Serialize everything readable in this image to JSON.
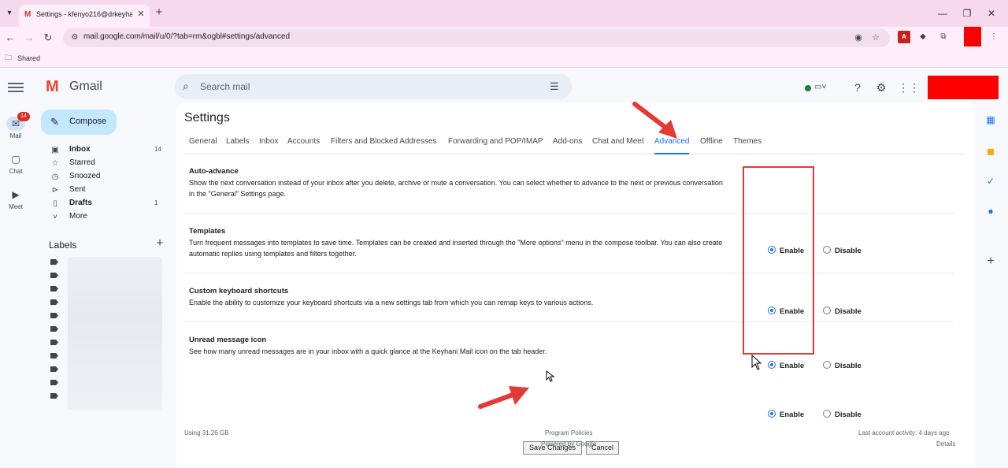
{
  "browser": {
    "tab_title": "Settings - kfenyo216@drkeyhani.c",
    "url": "mail.google.com/mail/u/0/?tab=rm&ogbl#settings/advanced",
    "bookmark": "Shared"
  },
  "gmail": {
    "logo_text": "Gmail",
    "search_placeholder": "Search mail",
    "compose_label": "Compose",
    "rail": [
      {
        "label": "Mail",
        "badge": "14"
      },
      {
        "label": "Chat"
      },
      {
        "label": "Meet"
      }
    ],
    "nav": [
      {
        "label": "Inbox",
        "count": "14",
        "bold": true
      },
      {
        "label": "Starred",
        "count": ""
      },
      {
        "label": "Snoozed",
        "count": ""
      },
      {
        "label": "Sent",
        "count": ""
      },
      {
        "label": "Drafts",
        "count": "1",
        "bold": true
      },
      {
        "label": "More",
        "count": ""
      }
    ],
    "labels_heading": "Labels"
  },
  "settings": {
    "title": "Settings",
    "tabs": [
      "General",
      "Labels",
      "Inbox",
      "Accounts",
      "Filters and Blocked Addresses",
      "Forwarding and POP/IMAP",
      "Add-ons",
      "Chat and Meet",
      "Advanced",
      "Offline",
      "Themes"
    ],
    "active_tab": "Advanced",
    "rows": [
      {
        "title": "Auto-advance",
        "description": "Show the next conversation instead of your inbox after you delete, archive or mute a conversation. You can select whether to advance to the next or previous conversation in the \"General\" Settings page.",
        "selected": "Enable"
      },
      {
        "title": "Templates",
        "description": "Turn frequent messages into templates to save time. Templates can be created and inserted through the \"More options\" menu in the compose toolbar. You can also create automatic replies using templates and filters together.",
        "selected": "Enable"
      },
      {
        "title": "Custom keyboard shortcuts",
        "description": "Enable the ability to customize your keyboard shortcuts via a new settings tab from which you can remap keys to various actions.",
        "selected": "Enable"
      },
      {
        "title": "Unread message icon",
        "description": "See how many unread messages are in your inbox with a quick glance at the Keyhani Mail icon on the tab header.",
        "selected": "Enable"
      }
    ],
    "enable_label": "Enable",
    "disable_label": "Disable",
    "save_label": "Save Changes",
    "cancel_label": "Cancel"
  },
  "footer": {
    "storage": "Using 31.26 GB",
    "policies": "Program Policies",
    "powered": "Powered by Google",
    "activity": "Last account activity: 4 days ago",
    "details": "Details"
  },
  "colors": {
    "accent": "#1a73e8",
    "annotation_red": "#e53935",
    "tab_strip": "#f7d9ec"
  }
}
